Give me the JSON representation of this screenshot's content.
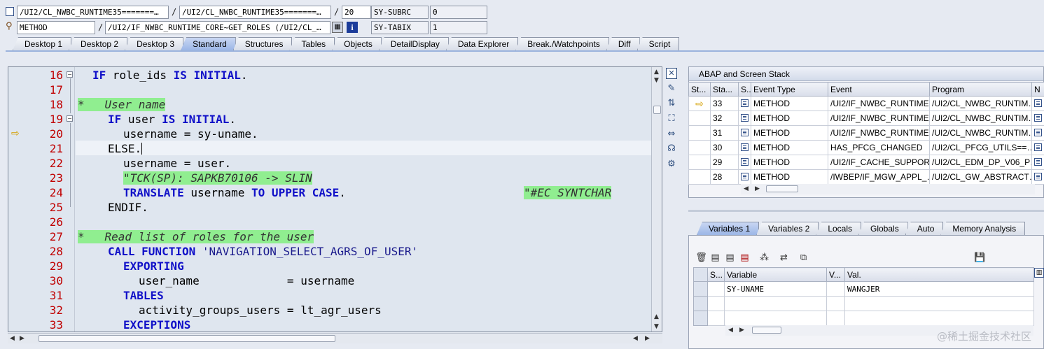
{
  "header": {
    "row1": {
      "field1": "/UI2/CL_NWBC_RUNTIME35=======…",
      "field2": "/UI2/CL_NWBC_RUNTIME35=======…",
      "line": "20",
      "sysfield": "SY-SUBRC",
      "sysvalue": "0"
    },
    "row2": {
      "type": "METHOD",
      "method": "/UI2/IF_NWBC_RUNTIME_CORE~GET_ROLES (/UI2/CL_…",
      "sysfield": "SY-TABIX",
      "sysvalue": "1"
    },
    "slash": "/"
  },
  "tabs": [
    "Desktop 1",
    "Desktop 2",
    "Desktop 3",
    "Standard",
    "Structures",
    "Tables",
    "Objects",
    "DetailDisplay",
    "Data Explorer",
    "Break./Watchpoints",
    "Diff",
    "Script"
  ],
  "active_tab": "Standard",
  "editor": {
    "lines": [
      {
        "n": "16"
      },
      {
        "n": "17"
      },
      {
        "n": "18"
      },
      {
        "n": "19"
      },
      {
        "n": "20"
      },
      {
        "n": "21"
      },
      {
        "n": "22"
      },
      {
        "n": "23"
      },
      {
        "n": "24"
      },
      {
        "n": "25"
      },
      {
        "n": "26"
      },
      {
        "n": "27"
      },
      {
        "n": "28"
      },
      {
        "n": "29"
      },
      {
        "n": "30"
      },
      {
        "n": "31"
      },
      {
        "n": "32"
      },
      {
        "n": "33"
      }
    ],
    "code": {
      "l16_kw1": "IF",
      "l16_txt": " role_ids ",
      "l16_kw2": "IS INITIAL",
      "l16_end": ".",
      "l18_cmt": "*   User name",
      "l19_kw1": "IF",
      "l19_txt": " user ",
      "l19_kw2": "IS INITIAL",
      "l19_end": ".",
      "l20": "username = sy-uname.",
      "l21": "ELSE.",
      "l22": "username = user.",
      "l23_cmt": "\"TCK(SP): SAPKB70106 -> SLIN",
      "l24_kw1": "TRANSLATE",
      "l24_txt": " username ",
      "l24_kw2": "TO UPPER CASE",
      "l24_end": ".",
      "l24_cmt": "\"#EC SYNTCHAR",
      "l25": "ENDIF.",
      "l27_cmt": "*   Read list of roles for the user",
      "l28_kw": "CALL FUNCTION",
      "l28_str": " 'NAVIGATION_SELECT_AGRS_OF_USER'",
      "l29_kw": "EXPORTING",
      "l30": "user_name             = username",
      "l31_kw": "TABLES",
      "l32": "activity_groups_users = lt_agr_users",
      "l33_kw": "EXCEPTIONS"
    }
  },
  "stack": {
    "title": "ABAP and Screen Stack",
    "columns": [
      "St...",
      "Sta...",
      "S..",
      "Event Type",
      "Event",
      "Program",
      "N"
    ],
    "rows": [
      {
        "level": "33",
        "type": "METHOD",
        "event": "/UI2/IF_NWBC_RUNTIME…",
        "program": "/UI2/CL_NWBC_RUNTIM…",
        "current": true
      },
      {
        "level": "32",
        "type": "METHOD",
        "event": "/UI2/IF_NWBC_RUNTIME…",
        "program": "/UI2/CL_NWBC_RUNTIM…",
        "current": false
      },
      {
        "level": "31",
        "type": "METHOD",
        "event": "/UI2/IF_NWBC_RUNTIME…",
        "program": "/UI2/CL_NWBC_RUNTIM…",
        "current": false
      },
      {
        "level": "30",
        "type": "METHOD",
        "event": "HAS_PFCG_CHANGED",
        "program": "/UI2/CL_PFCG_UTILS==…",
        "current": false
      },
      {
        "level": "29",
        "type": "METHOD",
        "event": "/UI2/IF_CACHE_SUPPOR…",
        "program": "/UI2/CL_EDM_DP_V06_P…",
        "current": false
      },
      {
        "level": "28",
        "type": "METHOD",
        "event": "/IWBEP/IF_MGW_APPL_…",
        "program": "/UI2/CL_GW_ABSTRACT…",
        "current": false
      }
    ]
  },
  "var_tabs": [
    "Variables 1",
    "Variables 2",
    "Locals",
    "Globals",
    "Auto",
    "Memory Analysis"
  ],
  "active_var_tab": "Variables 1",
  "variables": {
    "columns": [
      "S...",
      "Variable",
      "V...",
      "Val."
    ],
    "rows": [
      {
        "variable": "SY-UNAME",
        "value": "WANGJER"
      }
    ]
  },
  "watermark": "@稀土掘金技术社区"
}
